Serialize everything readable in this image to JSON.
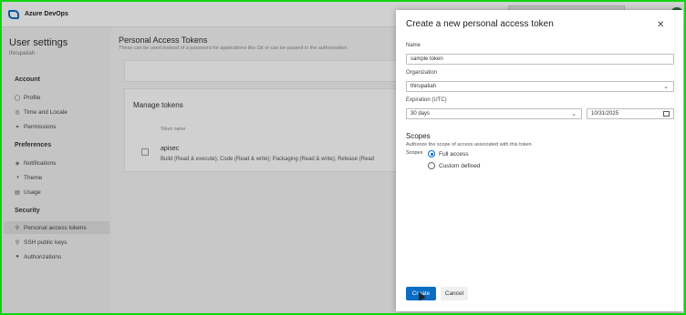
{
  "topbar": {
    "brand": "Azure DevOps"
  },
  "sidebar": {
    "title": "User settings",
    "user": "thirupatiah",
    "sections": [
      {
        "label": "Account",
        "items": [
          {
            "label": "Profile",
            "icon": "profile-icon"
          },
          {
            "label": "Time and Locale",
            "icon": "globe-icon"
          },
          {
            "label": "Permissions",
            "icon": "permissions-icon"
          }
        ]
      },
      {
        "label": "Preferences",
        "items": [
          {
            "label": "Notifications",
            "icon": "notifications-icon"
          },
          {
            "label": "Theme",
            "icon": "theme-icon"
          },
          {
            "label": "Usage",
            "icon": "usage-icon"
          }
        ]
      },
      {
        "label": "Security",
        "items": [
          {
            "label": "Personal access tokens",
            "icon": "key-icon",
            "active": true
          },
          {
            "label": "SSH public keys",
            "icon": "ssh-key-icon"
          },
          {
            "label": "Authorizations",
            "icon": "lock-icon"
          }
        ]
      }
    ]
  },
  "main": {
    "title": "Personal Access Tokens",
    "subtitle": "These can be used instead of a password for applications like Git or can be passed in the authorization",
    "manage_title": "Manage tokens",
    "column_token": "Token name",
    "token": {
      "name": "apisec",
      "scopes": "Build (Read & execute); Code (Read & write); Packaging (Read & write); Release (Read"
    }
  },
  "panel": {
    "title": "Create a new personal access token",
    "name_label": "Name",
    "name_value": "sample token",
    "org_label": "Organization",
    "org_value": "thirupatiah",
    "expiration_label": "Expiration (UTC)",
    "expiration_value": "30 days",
    "date_value": "10/31/2025",
    "scopes_heading": "Scopes",
    "scopes_desc": "Authorize the scope of access associated with this token",
    "scopes_label": "Scopes",
    "scope_options": [
      {
        "label": "Full access",
        "selected": true
      },
      {
        "label": "Custom defined",
        "selected": false
      }
    ],
    "create_label": "Create",
    "cancel_label": "Cancel"
  },
  "colors": {
    "accent": "#0a6cc2",
    "frame": "#0fd40f"
  }
}
